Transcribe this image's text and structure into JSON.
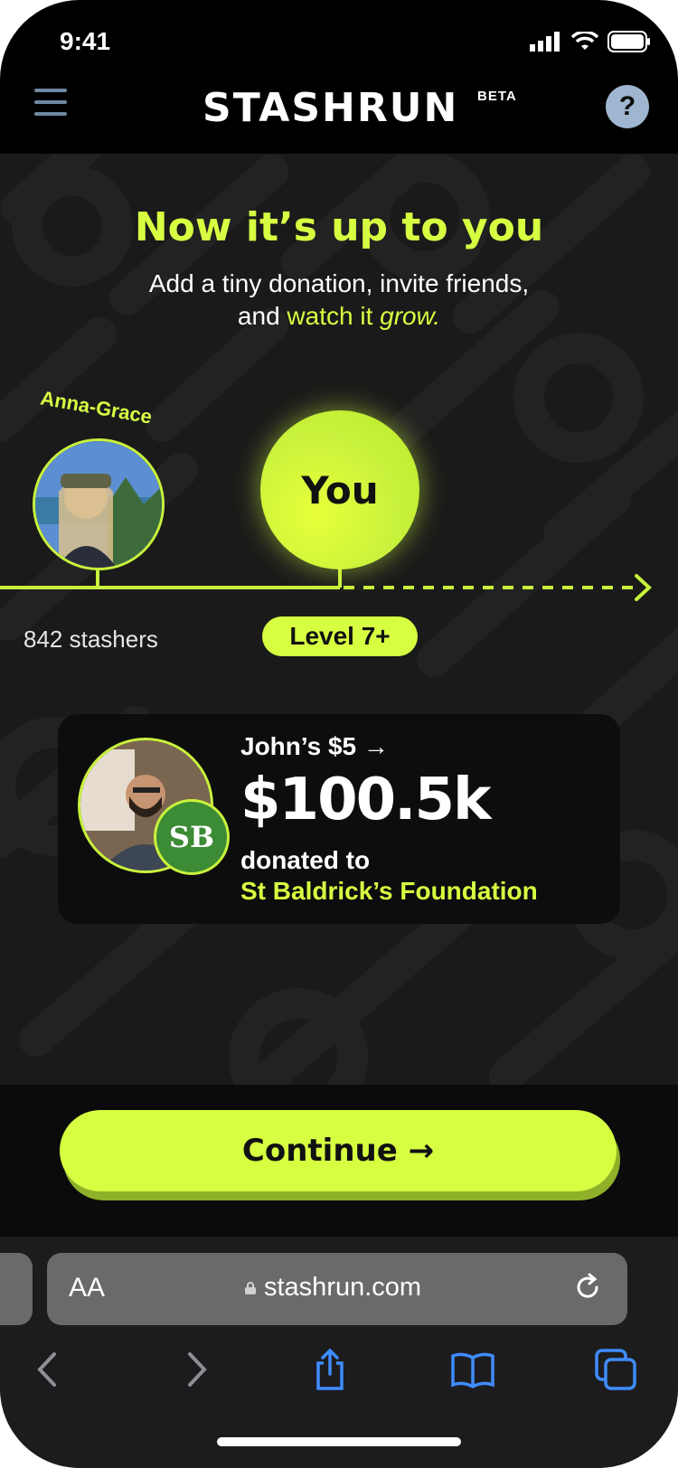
{
  "status": {
    "time": "9:41"
  },
  "header": {
    "logo": "STASHRUN",
    "badge": "BETA",
    "help": "?"
  },
  "hero": {
    "headline": "Now it’s up to you",
    "sub_line1": "Add a tiny donation, invite friends,",
    "sub_and": "and ",
    "sub_watch": "watch it ",
    "sub_grow": "grow."
  },
  "progress": {
    "left_user": "Anna-Grace",
    "you_label": "You",
    "stashers": "842 stashers",
    "level": "Level 7+"
  },
  "card": {
    "john_line": "John’s $5 →",
    "amount": "$100.5k",
    "donated_to": "donated to",
    "org": "St Baldrick’s Foundation"
  },
  "action": {
    "continue_label": "Continue →"
  },
  "browser": {
    "aa": "AA",
    "url": "stashrun.com"
  },
  "colors": {
    "accent": "#d7ff41",
    "background": "#1a1a1a",
    "menu": "#6f87a3"
  }
}
